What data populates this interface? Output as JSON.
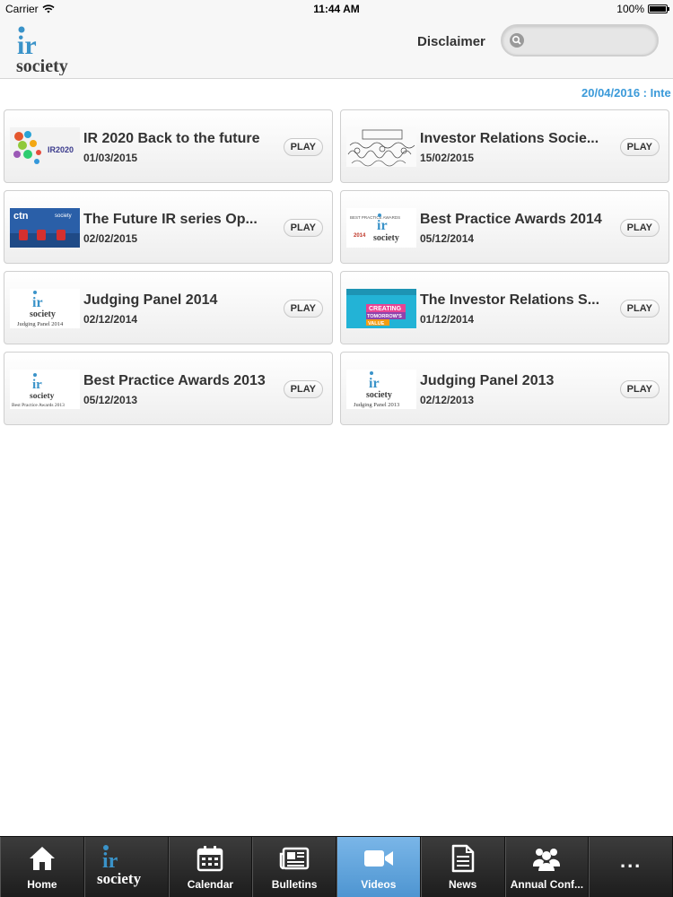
{
  "status_bar": {
    "carrier": "Carrier",
    "time": "11:44 AM",
    "battery": "100%"
  },
  "header": {
    "logo_icon": "ir-society-logo",
    "disclaimer": "Disclaimer",
    "search_placeholder": ""
  },
  "ticker": "20/04/2016 : Inte",
  "videos": [
    {
      "title": "IR 2020 Back to the future",
      "date": "01/03/2015",
      "play": "PLAY"
    },
    {
      "title": "Investor Relations Socie...",
      "date": "15/02/2015",
      "play": "PLAY"
    },
    {
      "title": "The Future IR series Op...",
      "date": "02/02/2015",
      "play": "PLAY"
    },
    {
      "title": "Best Practice Awards 2014",
      "date": "05/12/2014",
      "play": "PLAY"
    },
    {
      "title": "Judging Panel 2014",
      "date": "02/12/2014",
      "play": "PLAY"
    },
    {
      "title": "The Investor Relations S...",
      "date": "01/12/2014",
      "play": "PLAY"
    },
    {
      "title": "Best Practice Awards 2013",
      "date": "05/12/2013",
      "play": "PLAY"
    },
    {
      "title": "Judging Panel 2013",
      "date": "02/12/2013",
      "play": "PLAY"
    }
  ],
  "thumbs": {
    "ir2020": "IR2020",
    "ctn": "ctn",
    "bpa2014_text": "BEST PRACTICE AWARDS",
    "bpa2014_year": "2014",
    "judging2014": "Judging Panel 2014",
    "creating": "CREATING",
    "tomorrows": "TOMORROW'S",
    "value": "VALUE",
    "bpa2013": "Best Practice Awards 2013",
    "judging2013": "Judging Panel 2013",
    "ir": "ir",
    "society": "society"
  },
  "tabs": [
    {
      "label": "Home",
      "icon": "home-icon"
    },
    {
      "label": "",
      "icon": "ir-society-logo"
    },
    {
      "label": "Calendar",
      "icon": "calendar-icon"
    },
    {
      "label": "Bulletins",
      "icon": "newspaper-icon"
    },
    {
      "label": "Videos",
      "icon": "video-camera-icon",
      "active": true
    },
    {
      "label": "News",
      "icon": "document-icon"
    },
    {
      "label": "Annual Conf...",
      "icon": "people-icon"
    },
    {
      "label": "...",
      "icon": "more-icon"
    }
  ],
  "colors": {
    "accent": "#3b9ad9",
    "active_tab": "#5b9fd8",
    "ir_blue": "#3a93c9"
  }
}
